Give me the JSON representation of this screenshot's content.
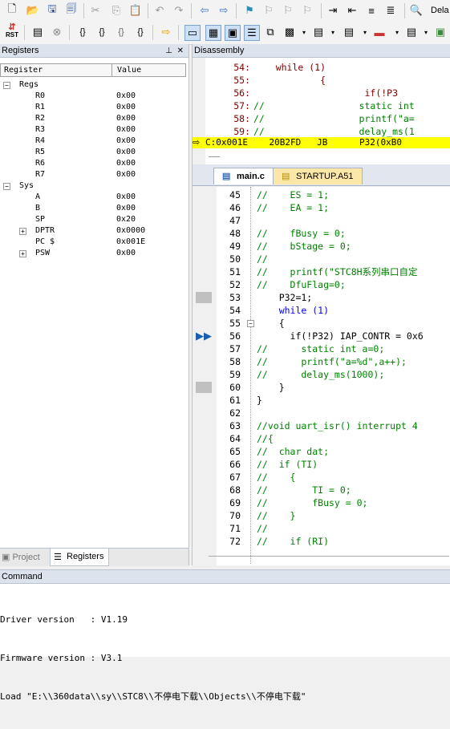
{
  "toolbar1": {
    "debug_target_label": "Dela"
  },
  "toolbar2": {
    "rst_label": "RST"
  },
  "registers_pane": {
    "title": "Registers",
    "col_register": "Register",
    "col_value": "Value",
    "rows": [
      {
        "name": "Regs",
        "value": "",
        "level": 0,
        "expander": "−"
      },
      {
        "name": "R0",
        "value": "0x00",
        "level": 2,
        "expander": ""
      },
      {
        "name": "R1",
        "value": "0x00",
        "level": 2,
        "expander": ""
      },
      {
        "name": "R2",
        "value": "0x00",
        "level": 2,
        "expander": ""
      },
      {
        "name": "R3",
        "value": "0x00",
        "level": 2,
        "expander": ""
      },
      {
        "name": "R4",
        "value": "0x00",
        "level": 2,
        "expander": ""
      },
      {
        "name": "R5",
        "value": "0x00",
        "level": 2,
        "expander": ""
      },
      {
        "name": "R6",
        "value": "0x00",
        "level": 2,
        "expander": ""
      },
      {
        "name": "R7",
        "value": "0x00",
        "level": 2,
        "expander": ""
      },
      {
        "name": "Sys",
        "value": "",
        "level": 0,
        "expander": "−"
      },
      {
        "name": "A",
        "value": "0x00",
        "level": 2,
        "expander": ""
      },
      {
        "name": "B",
        "value": "0x00",
        "level": 2,
        "expander": ""
      },
      {
        "name": "SP",
        "value": "0x20",
        "level": 2,
        "expander": ""
      },
      {
        "name": "DPTR",
        "value": "0x0000",
        "level": 1,
        "expander": "+"
      },
      {
        "name": "PC $",
        "value": "0x001E",
        "level": 2,
        "expander": ""
      },
      {
        "name": "PSW",
        "value": "0x00",
        "level": 1,
        "expander": "+"
      }
    ],
    "tab_project": "Project",
    "tab_registers": "Registers"
  },
  "disassembly": {
    "title": "Disassembly",
    "lines": [
      {
        "num": "54:",
        "text": "    while (1)"
      },
      {
        "num": "55:",
        "text": "            {"
      },
      {
        "num": "56:",
        "text": "                    if(!P3"
      },
      {
        "num": "57:",
        "text": "//                 static int"
      },
      {
        "num": "58:",
        "text": "//                 printf(\"a="
      },
      {
        "num": "59:",
        "text": "//                 delay_ms(1"
      }
    ],
    "current_line": "C:0x001E    20B2FD   JB      P32(0xB0"
  },
  "editor": {
    "tab_main": "main.c",
    "tab_startup": "STARTUP.A51",
    "lines": [
      {
        "num": "45",
        "text": "//    ES = 1;"
      },
      {
        "num": "46",
        "text": "//    EA = 1;"
      },
      {
        "num": "47",
        "text": ""
      },
      {
        "num": "48",
        "text": "//    fBusy = 0;"
      },
      {
        "num": "49",
        "text": "//    bStage = 0;"
      },
      {
        "num": "50",
        "text": "//"
      },
      {
        "num": "51",
        "text": "//    printf(\"STC8H系列串口自定"
      },
      {
        "num": "52",
        "text": "//    DfuFlag=0;"
      },
      {
        "num": "53",
        "text": "    P32=1;"
      },
      {
        "num": "54",
        "text": "    while (1)"
      },
      {
        "num": "55",
        "text": "    {"
      },
      {
        "num": "56",
        "text": "      if(!P32) IAP_CONTR = 0x6"
      },
      {
        "num": "57",
        "text": "//      static int a=0;"
      },
      {
        "num": "58",
        "text": "//      printf(\"a=%d\",a++);"
      },
      {
        "num": "59",
        "text": "//      delay_ms(1000);"
      },
      {
        "num": "60",
        "text": "    }"
      },
      {
        "num": "61",
        "text": "}"
      },
      {
        "num": "62",
        "text": ""
      },
      {
        "num": "63",
        "text": "//void uart_isr() interrupt 4"
      },
      {
        "num": "64",
        "text": "//{"
      },
      {
        "num": "65",
        "text": "//  char dat;"
      },
      {
        "num": "66",
        "text": "//  if (TI)"
      },
      {
        "num": "67",
        "text": "//    {"
      },
      {
        "num": "68",
        "text": "//        TI = 0;"
      },
      {
        "num": "69",
        "text": "//        fBusy = 0;"
      },
      {
        "num": "70",
        "text": "//    }"
      },
      {
        "num": "71",
        "text": "//"
      },
      {
        "num": "72",
        "text": "//    if (RI)"
      }
    ]
  },
  "command": {
    "title": "Command",
    "lines": [
      "Driver version   : V1.19",
      "Firmware version : V3.1",
      "Load \"E:\\\\360data\\\\sy\\\\STC8\\\\不停电下载\\\\Objects\\\\不停电下载\""
    ]
  },
  "colors": {
    "current_line_bg": "#ffff00",
    "comment": "#008000",
    "keyword": "#0000ff",
    "pane_header": "#dde3ec"
  }
}
